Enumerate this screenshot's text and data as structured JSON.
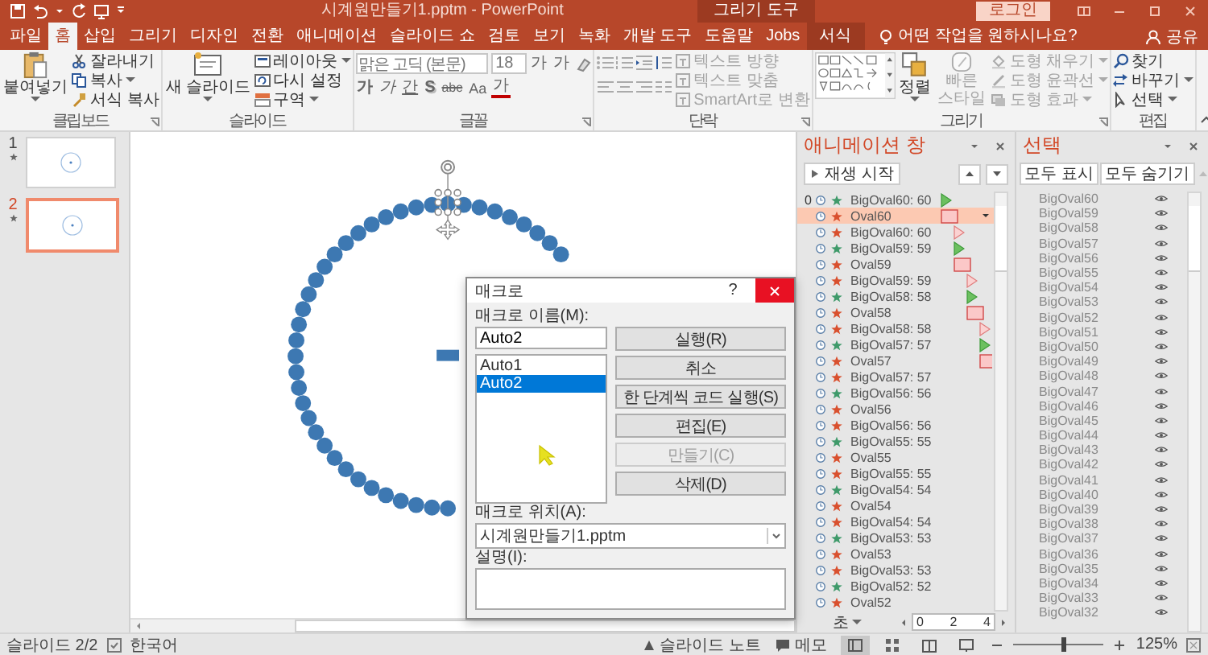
{
  "title_bar": {
    "document_title": "시계원만들기1.pptm - PowerPoint",
    "context_label": "그리기 도구",
    "login_button": "로그인"
  },
  "tabs": [
    {
      "label": "파일",
      "selected": false,
      "kind": "normal"
    },
    {
      "label": "홈",
      "selected": true,
      "kind": "normal"
    },
    {
      "label": "삽입",
      "selected": false,
      "kind": "normal"
    },
    {
      "label": "그리기",
      "selected": false,
      "kind": "normal"
    },
    {
      "label": "디자인",
      "selected": false,
      "kind": "normal"
    },
    {
      "label": "전환",
      "selected": false,
      "kind": "normal"
    },
    {
      "label": "애니메이션",
      "selected": false,
      "kind": "normal"
    },
    {
      "label": "슬라이드 쇼",
      "selected": false,
      "kind": "normal"
    },
    {
      "label": "검토",
      "selected": false,
      "kind": "normal"
    },
    {
      "label": "보기",
      "selected": false,
      "kind": "normal"
    },
    {
      "label": "녹화",
      "selected": false,
      "kind": "normal"
    },
    {
      "label": "개발 도구",
      "selected": false,
      "kind": "normal"
    },
    {
      "label": "도움말",
      "selected": false,
      "kind": "normal"
    },
    {
      "label": "Jobs",
      "selected": false,
      "kind": "normal"
    },
    {
      "label": "서식",
      "selected": false,
      "kind": "contextual"
    }
  ],
  "tell_me": {
    "placeholder": "어떤 작업을 원하시나요?"
  },
  "share_button": "공유",
  "ribbon": {
    "clipboard": {
      "label": "클립보드",
      "paste": "붙여넣기",
      "buttons": [
        "잘라내기",
        "복사",
        "서식 복사"
      ]
    },
    "slides": {
      "label": "슬라이드",
      "new_slide": "새 슬라이드",
      "buttons": [
        "레이아웃",
        "다시 설정",
        "구역"
      ]
    },
    "font": {
      "label": "글꼴",
      "font_name": "맑은 고딕 (본문)",
      "font_size": "18",
      "size_buttons": [
        "가",
        "가"
      ],
      "format_buttons": [
        {
          "label": "가",
          "kind": "bold"
        },
        {
          "label": "가",
          "kind": "italic"
        },
        {
          "label": "간",
          "kind": "underline"
        },
        {
          "label": "S",
          "kind": "shadow"
        },
        {
          "label": "abc",
          "kind": "strike"
        },
        {
          "label": "Aa",
          "kind": "case"
        },
        {
          "label": "가",
          "kind": "color"
        }
      ]
    },
    "paragraph": {
      "label": "단락",
      "text_buttons": [
        {
          "label": "텍스트 방향",
          "disabled": true
        },
        {
          "label": "텍스트 맞춤",
          "disabled": true
        },
        {
          "label": "SmartArt로 변환",
          "disabled": true
        }
      ]
    },
    "drawing": {
      "label": "그리기",
      "arrange": "정렬",
      "quick_styles": {
        "label": "빠른 스타일",
        "disabled": true
      },
      "shape_buttons": [
        {
          "label": "도형 채우기",
          "disabled": true
        },
        {
          "label": "도형 윤곽선",
          "disabled": true
        },
        {
          "label": "도형 효과",
          "disabled": true
        }
      ]
    },
    "editing": {
      "label": "편집",
      "buttons": [
        "찾기",
        "바꾸기",
        "선택"
      ]
    }
  },
  "slides_panel": [
    {
      "number": "1",
      "selected": false
    },
    {
      "number": "2",
      "selected": true
    }
  ],
  "macro_dialog": {
    "title": "매크로",
    "help": "?",
    "name_label": "매크로 이름(M):",
    "name_value": "Auto2",
    "macros": [
      {
        "name": "Auto1",
        "selected": false
      },
      {
        "name": "Auto2",
        "selected": true
      }
    ],
    "buttons": [
      {
        "label": "실행(R)",
        "disabled": false
      },
      {
        "label": "취소",
        "disabled": false
      },
      {
        "label": "한 단계씩 코드 실행(S)",
        "disabled": false
      },
      {
        "label": "편집(E)",
        "disabled": false
      },
      {
        "label": "만들기(C)",
        "disabled": true
      },
      {
        "label": "삭제(D)",
        "disabled": false
      }
    ],
    "location_label": "매크로 위치(A):",
    "location_value": "시계원만들기1.pptm",
    "description_label": "설명(I):"
  },
  "animation_pane": {
    "title": "애니메이션 창",
    "play_button": "재생 시작",
    "items": [
      {
        "number": "0",
        "name": "BigOval60: 60",
        "kind": "entrance",
        "selected": false
      },
      {
        "name": "Oval60",
        "kind": "exit-bar",
        "selected": true
      },
      {
        "name": "BigOval60: 60",
        "kind": "exit",
        "selected": false
      },
      {
        "name": "BigOval59: 59",
        "kind": "entrance",
        "selected": false
      },
      {
        "name": "Oval59",
        "kind": "exit-bar",
        "selected": false
      },
      {
        "name": "BigOval59: 59",
        "kind": "exit",
        "selected": false
      },
      {
        "name": "BigOval58: 58",
        "kind": "entrance",
        "selected": false
      },
      {
        "name": "Oval58",
        "kind": "exit-bar",
        "selected": false
      },
      {
        "name": "BigOval58: 58",
        "kind": "exit",
        "selected": false
      },
      {
        "name": "BigOval57: 57",
        "kind": "entrance",
        "selected": false
      },
      {
        "name": "Oval57",
        "kind": "exit-bar",
        "selected": false
      },
      {
        "name": "BigOval57: 57",
        "kind": "exit",
        "selected": false
      },
      {
        "name": "BigOval56: 56",
        "kind": "entrance",
        "selected": false
      },
      {
        "name": "Oval56",
        "kind": "exit-bar",
        "selected": false
      },
      {
        "name": "BigOval56: 56",
        "kind": "exit",
        "selected": false
      },
      {
        "name": "BigOval55: 55",
        "kind": "entrance",
        "selected": false
      },
      {
        "name": "Oval55",
        "kind": "exit-bar",
        "selected": false
      },
      {
        "name": "BigOval55: 55",
        "kind": "exit",
        "selected": false
      },
      {
        "name": "BigOval54: 54",
        "kind": "entrance",
        "selected": false
      },
      {
        "name": "Oval54",
        "kind": "exit-bar",
        "selected": false
      },
      {
        "name": "BigOval54: 54",
        "kind": "exit",
        "selected": false
      },
      {
        "name": "BigOval53: 53",
        "kind": "entrance",
        "selected": false
      },
      {
        "name": "Oval53",
        "kind": "exit-bar",
        "selected": false
      },
      {
        "name": "BigOval53: 53",
        "kind": "exit",
        "selected": false
      },
      {
        "name": "BigOval52: 52",
        "kind": "entrance",
        "selected": false
      },
      {
        "name": "Oval52",
        "kind": "exit-bar",
        "selected": false
      }
    ],
    "unit": "초",
    "scale": [
      "0",
      "2",
      "4"
    ]
  },
  "selection_pane": {
    "title": "선택",
    "show_all": "모두 표시",
    "hide_all": "모두 숨기기",
    "items": [
      "BigOval60",
      "BigOval59",
      "BigOval58",
      "BigOval57",
      "BigOval56",
      "BigOval55",
      "BigOval54",
      "BigOval53",
      "BigOval52",
      "BigOval51",
      "BigOval50",
      "BigOval49",
      "BigOval48",
      "BigOval47",
      "BigOval46",
      "BigOval45",
      "BigOval44",
      "BigOval43",
      "BigOval42",
      "BigOval41",
      "BigOval40",
      "BigOval39",
      "BigOval38",
      "BigOval37",
      "BigOval36",
      "BigOval35",
      "BigOval34",
      "BigOval33",
      "BigOval32"
    ]
  },
  "status_bar": {
    "slide_info": "슬라이드 2/2",
    "language": "한국어",
    "notes": "슬라이드 노트",
    "comments": "메모",
    "views": [
      {
        "kind": "normal",
        "selected": true
      },
      {
        "kind": "sorter",
        "selected": false
      },
      {
        "kind": "reading",
        "selected": false
      },
      {
        "kind": "slideshow",
        "selected": false
      }
    ],
    "zoom": {
      "level": 0.55,
      "reading": "125%"
    }
  }
}
